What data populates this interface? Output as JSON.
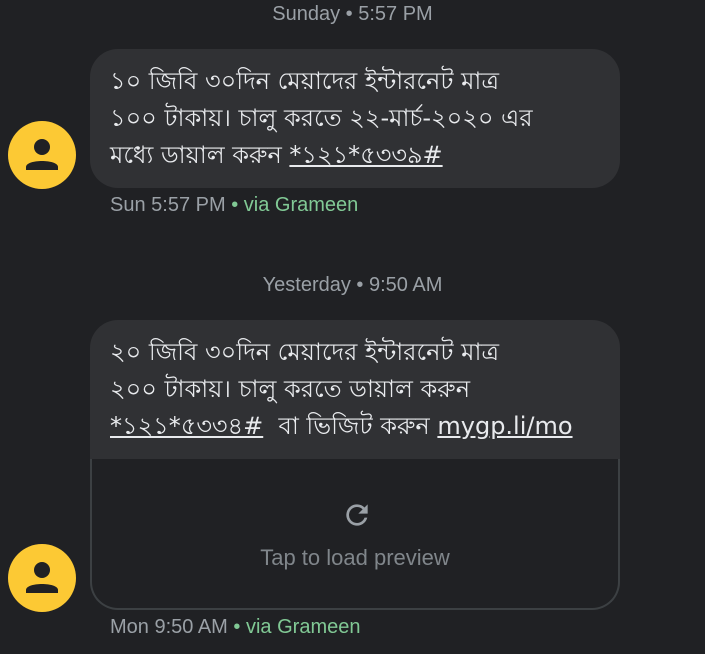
{
  "conversation": {
    "messages": [
      {
        "divider": "Sunday • 5:57 PM",
        "line1": "১০ জিবি ৩০দিন মেয়াদের ইন্টারনেট মাত্র",
        "line2": "১০০ টাকায়। চালু করতে ২২-মার্চ-২০২০ এর",
        "line3_prefix": "মধ্যে ডায়াল করুন ",
        "code": "*১২১*৫৩৩৯#",
        "time": "Sun 5:57 PM",
        "separator": "•",
        "via": "via Grameen"
      },
      {
        "divider": "Yesterday • 9:50 AM",
        "line1": "২০ জিবি ৩০দিন মেয়াদের ইন্টারনেট মাত্র",
        "line2": "২০০ টাকায়। চালু করতে ডায়াল করুন",
        "code": "*১২১*৫৩৩৪#",
        "middle": "  বা ভিজিট করুন ",
        "url": "mygp.li/mo",
        "preview_label": "Tap to load preview",
        "time": "Mon 9:50 AM",
        "separator": "•",
        "via": "via Grameen"
      }
    ]
  },
  "colors": {
    "background": "#202124",
    "bubble": "#303134",
    "avatar": "#fcc934",
    "via_green": "#81c995"
  },
  "icons": {
    "avatar": "person-icon",
    "reload": "refresh-icon"
  }
}
